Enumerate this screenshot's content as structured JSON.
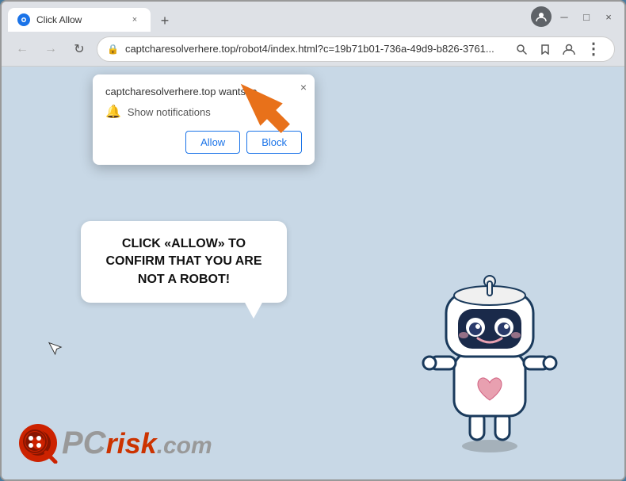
{
  "window": {
    "title": "Click Allow",
    "tab_close": "×",
    "new_tab": "+",
    "minimize": "─",
    "maximize": "□",
    "close": "×"
  },
  "nav": {
    "back": "←",
    "forward": "→",
    "refresh": "↻",
    "url": "captcharesolverhere.top/robot4/index.html?c=19b71b01-736a-49d9-b826-3761...",
    "lock_label": "🔒"
  },
  "notification_popup": {
    "header": "captcharesolverhere.top wants to",
    "close_btn": "×",
    "notification_label": "Show notifications",
    "allow_btn": "Allow",
    "block_btn": "Block"
  },
  "speech_bubble": {
    "text": "CLICK «ALLOW» TO CONFIRM THAT YOU ARE NOT A ROBOT!"
  },
  "pcrisk": {
    "pc": "PC",
    "risk": "risk",
    "dot": ".",
    "com": "com"
  },
  "colors": {
    "orange_arrow": "#e8711a",
    "allow_btn_border": "#1a73e8",
    "block_btn_border": "#1a73e8",
    "speech_text": "#111111",
    "background": "#c8d8e6"
  }
}
